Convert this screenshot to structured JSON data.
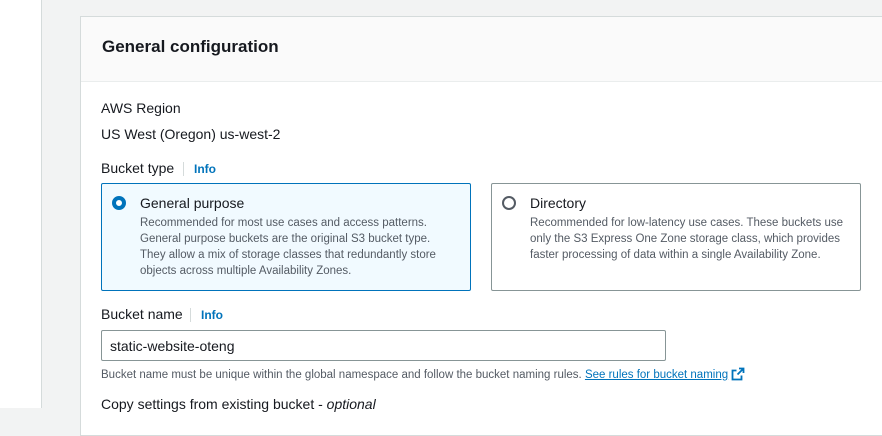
{
  "section": {
    "title": "General configuration"
  },
  "region": {
    "label": "AWS Region",
    "value": "US West (Oregon) us-west-2"
  },
  "bucket_type": {
    "label": "Bucket type",
    "info": "Info",
    "options": [
      {
        "title": "General purpose",
        "description": "Recommended for most use cases and access patterns. General purpose buckets are the original S3 bucket type. They allow a mix of storage classes that redundantly store objects across multiple Availability Zones.",
        "selected": true
      },
      {
        "title": "Directory",
        "description": "Recommended for low-latency use cases. These buckets use only the S3 Express One Zone storage class, which provides faster processing of data within a single Availability Zone.",
        "selected": false
      }
    ]
  },
  "bucket_name": {
    "label": "Bucket name",
    "info": "Info",
    "value": "static-website-oteng",
    "help": "Bucket name must be unique within the global namespace and follow the bucket naming rules.",
    "help_link": "See rules for bucket naming"
  },
  "copy_settings": {
    "label": "Copy settings from existing bucket - ",
    "optional": "optional"
  },
  "colors": {
    "accent": "#0073bb",
    "selected_bg": "#f1faff",
    "text": "#16191f",
    "muted": "#545b64"
  }
}
